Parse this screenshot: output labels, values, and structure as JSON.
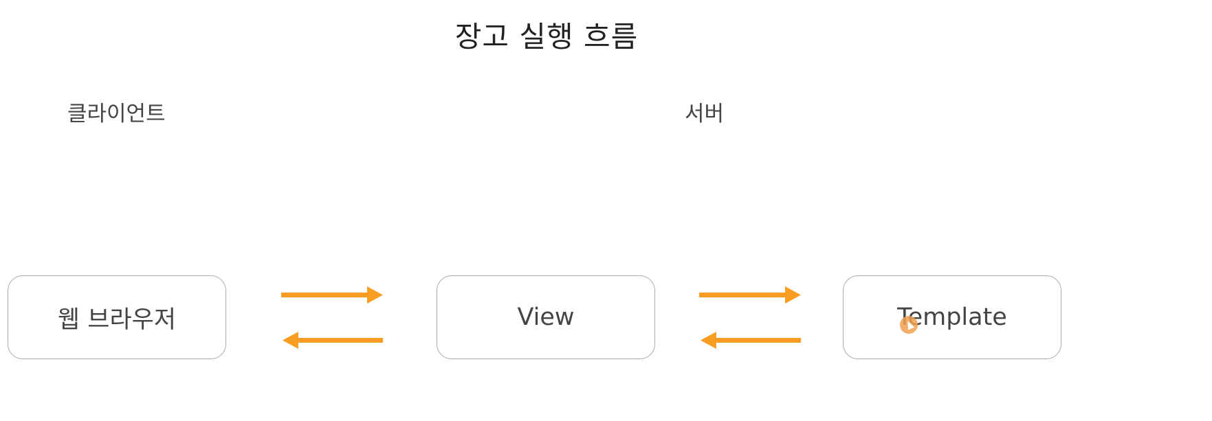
{
  "title": "장고 실행 흐름",
  "labels": {
    "client": "클라이언트",
    "server": "서버"
  },
  "boxes": {
    "browser": "웹 브라우저",
    "view": "View",
    "template": "Template"
  },
  "colors": {
    "arrow": "#f99d22",
    "box_border": "#a9a9a9",
    "cursor": "#f0a050"
  },
  "icons": {
    "cursor": "mouse-pointer-icon"
  }
}
